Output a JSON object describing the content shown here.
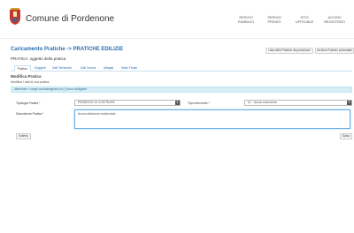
{
  "header": {
    "site_title": "Comune di Pordenone",
    "nav": [
      {
        "line1": "SERVIZI",
        "line2": "PUBBLICI"
      },
      {
        "line1": "SERVIZI",
        "line2": "PRIVATI"
      },
      {
        "line1": "SITO",
        "line2": "UFFICIALE"
      },
      {
        "line1": "ACCEDI",
        "line2": "REGISTRATI"
      }
    ]
  },
  "page": {
    "title": "Caricamento Pratiche -> PRATICHE EDILIZIE",
    "btn_list": "Lista delle Pratiche da presentare",
    "btn_archive": "Archivio Pratiche presentate",
    "subtitle": "PRATICA: oggetto della pratica"
  },
  "tabs": [
    "Pratica",
    "Soggetti",
    "Dati Territoriali",
    "Dati Tecnici",
    "Allegati",
    "Stato Finale"
  ],
  "form": {
    "section_title": "Modifica Pratica",
    "section_sub": "Modifica i dati di una pratica",
    "alert": "Attenzione: i campi contrassegnati con (*) sono obbligatori",
    "tipologia_label": "Tipologia Pratica *",
    "tipologia_value": "PERMESSO DI COSTRUIRE",
    "tipo_intervento_label": "Tipo Intervento *",
    "tipo_intervento_value": "A1 - Nuova costruzione",
    "descrizione_label": "Descrizione Pratica *",
    "descrizione_value": "Nuova abitazione residenziale",
    "btn_back": "Indietro",
    "btn_save": "Salva"
  }
}
